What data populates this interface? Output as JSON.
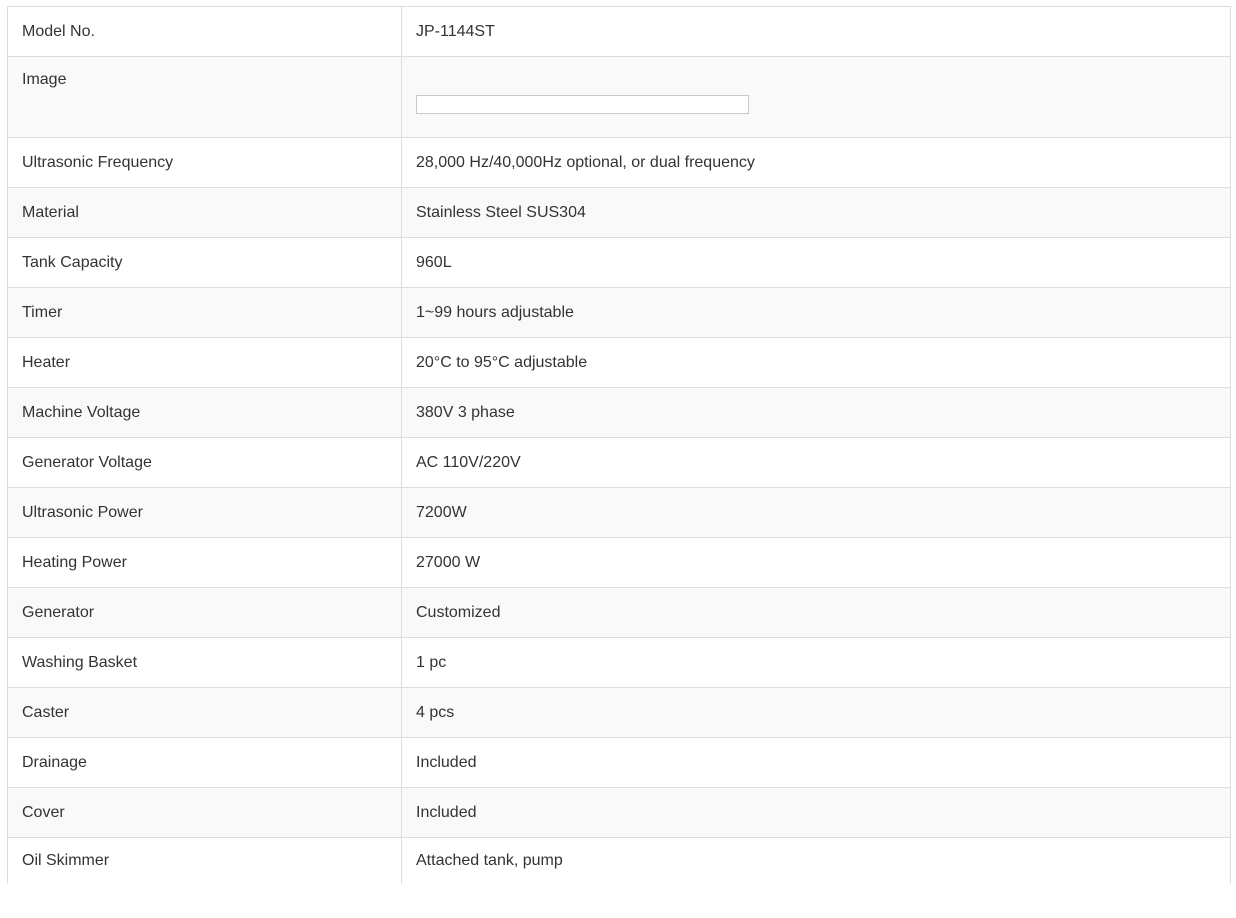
{
  "spec_table": {
    "rows": [
      {
        "label": "Model No.",
        "value": "JP-1144ST"
      },
      {
        "label": "Image",
        "value": ""
      },
      {
        "label": "Ultrasonic Frequency",
        "value": "28,000 Hz/40,000Hz optional, or dual frequency"
      },
      {
        "label": "Material",
        "value": "Stainless Steel SUS304"
      },
      {
        "label": "Tank Capacity",
        "value": "960L"
      },
      {
        "label": "Timer",
        "value": "1~99 hours adjustable"
      },
      {
        "label": "Heater",
        "value": "20°C to 95°C adjustable"
      },
      {
        "label": "Machine Voltage",
        "value": "380V 3 phase"
      },
      {
        "label": "Generator Voltage",
        "value": "AC 110V/220V"
      },
      {
        "label": "Ultrasonic Power",
        "value": "7200W"
      },
      {
        "label": "Heating Power",
        "value": "27000 W"
      },
      {
        "label": "Generator",
        "value": "Customized"
      },
      {
        "label": "Washing Basket",
        "value": "1 pc"
      },
      {
        "label": "Caster",
        "value": "4 pcs"
      },
      {
        "label": "Drainage",
        "value": "Included"
      },
      {
        "label": "Cover",
        "value": "Included"
      },
      {
        "label": "Oil Skimmer",
        "value": "Attached tank, pump"
      }
    ]
  },
  "colors": {
    "border": "#dddddd",
    "stripe": "#f9f9f9",
    "text": "#333333"
  }
}
